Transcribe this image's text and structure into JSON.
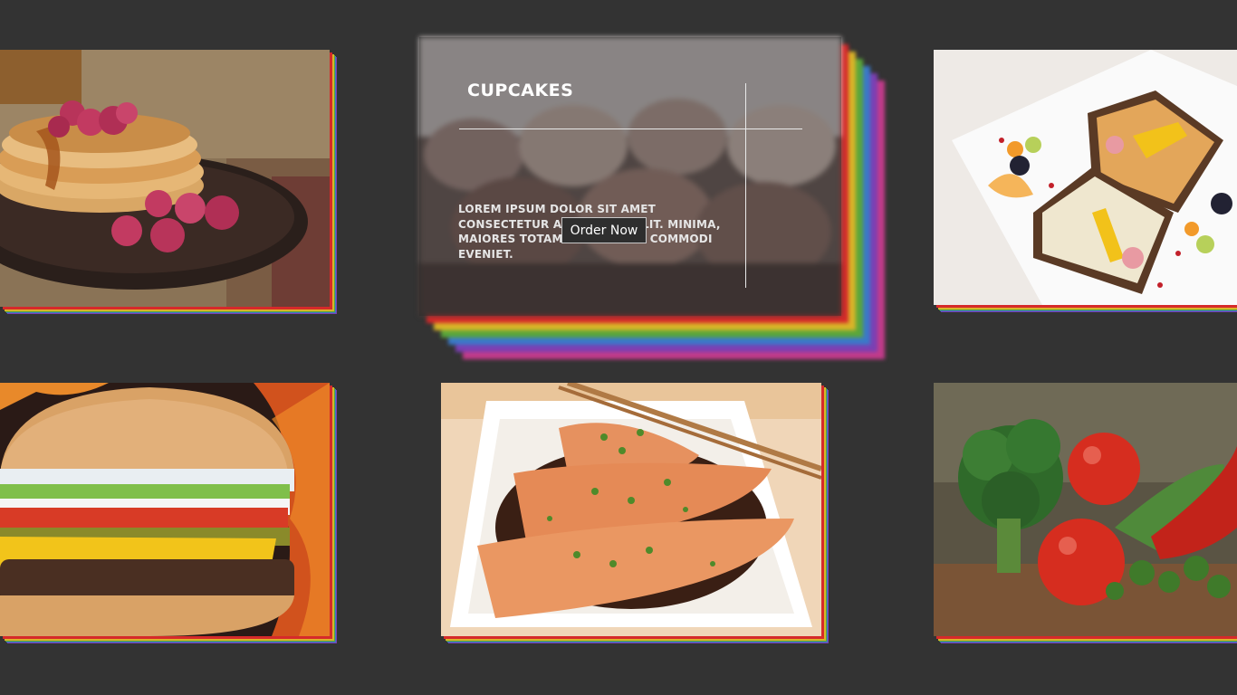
{
  "page": {
    "background": "#333333"
  },
  "cards": [
    {
      "id": "pancakes",
      "label": "Pancakes with raspberries"
    },
    {
      "id": "cupcakes",
      "title": "CUPCAKES",
      "description": "LOREM IPSUM DOLOR SIT AMET CONSECTETUR ADIPISICING ELIT. MINIMA, MAIORES TOTAM DOLORES EA COMMODI EVENIET.",
      "button_label": "Order Now"
    },
    {
      "id": "toast",
      "label": "Open sandwiches with fruit"
    },
    {
      "id": "burger",
      "label": "Cheeseburger"
    },
    {
      "id": "salmon",
      "label": "Grilled salmon"
    },
    {
      "id": "vegetables",
      "label": "Fresh vegetables"
    }
  ],
  "accent_colors": [
    "#d62a2a",
    "#e06a1f",
    "#d9b428",
    "#5aa63a",
    "#3a79c9",
    "#7b3fb3",
    "#c23b8a"
  ]
}
